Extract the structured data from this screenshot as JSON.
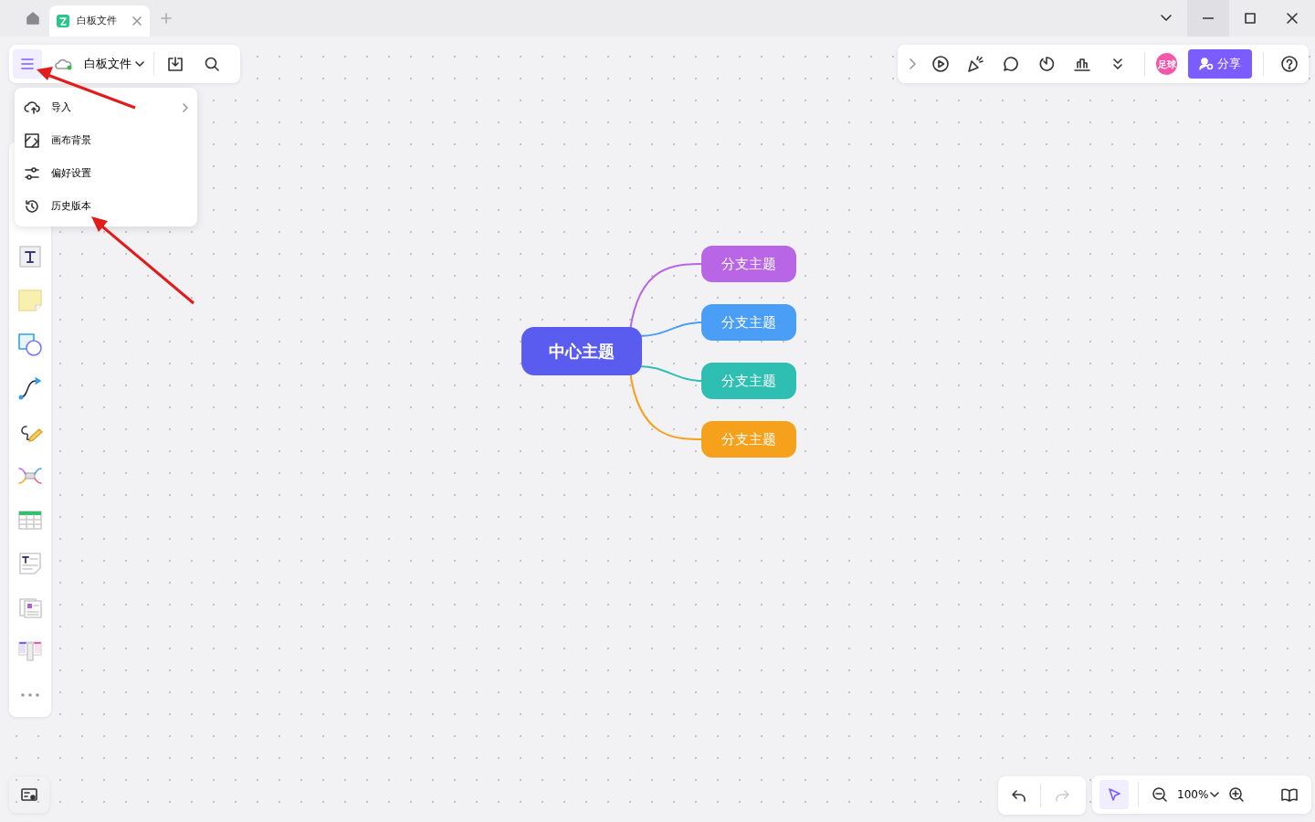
{
  "tabs": [
    {
      "label": "白板文件",
      "selected": true
    }
  ],
  "file_toolbar": {
    "file_name": "白板文件"
  },
  "menu": {
    "items": [
      {
        "label": "导入",
        "has_submenu": true
      },
      {
        "label": "画布背景",
        "has_submenu": false
      },
      {
        "label": "偏好设置",
        "has_submenu": false
      },
      {
        "label": "历史版本",
        "has_submenu": false
      }
    ]
  },
  "top_right": {
    "avatar": "足球",
    "share_button": "分享"
  },
  "mindmap": {
    "center": "中心主题",
    "branches": [
      {
        "label": "分支主题",
        "color": "#b865e6"
      },
      {
        "label": "分支主题",
        "color": "#4a9ef5"
      },
      {
        "label": "分支主题",
        "color": "#2fbfb2"
      },
      {
        "label": "分支主题",
        "color": "#f5a11c"
      }
    ]
  },
  "history": {
    "undo_disabled": false,
    "redo_disabled": true
  },
  "zoom_bar": {
    "select_selected": true,
    "zoom_text": "100%"
  }
}
